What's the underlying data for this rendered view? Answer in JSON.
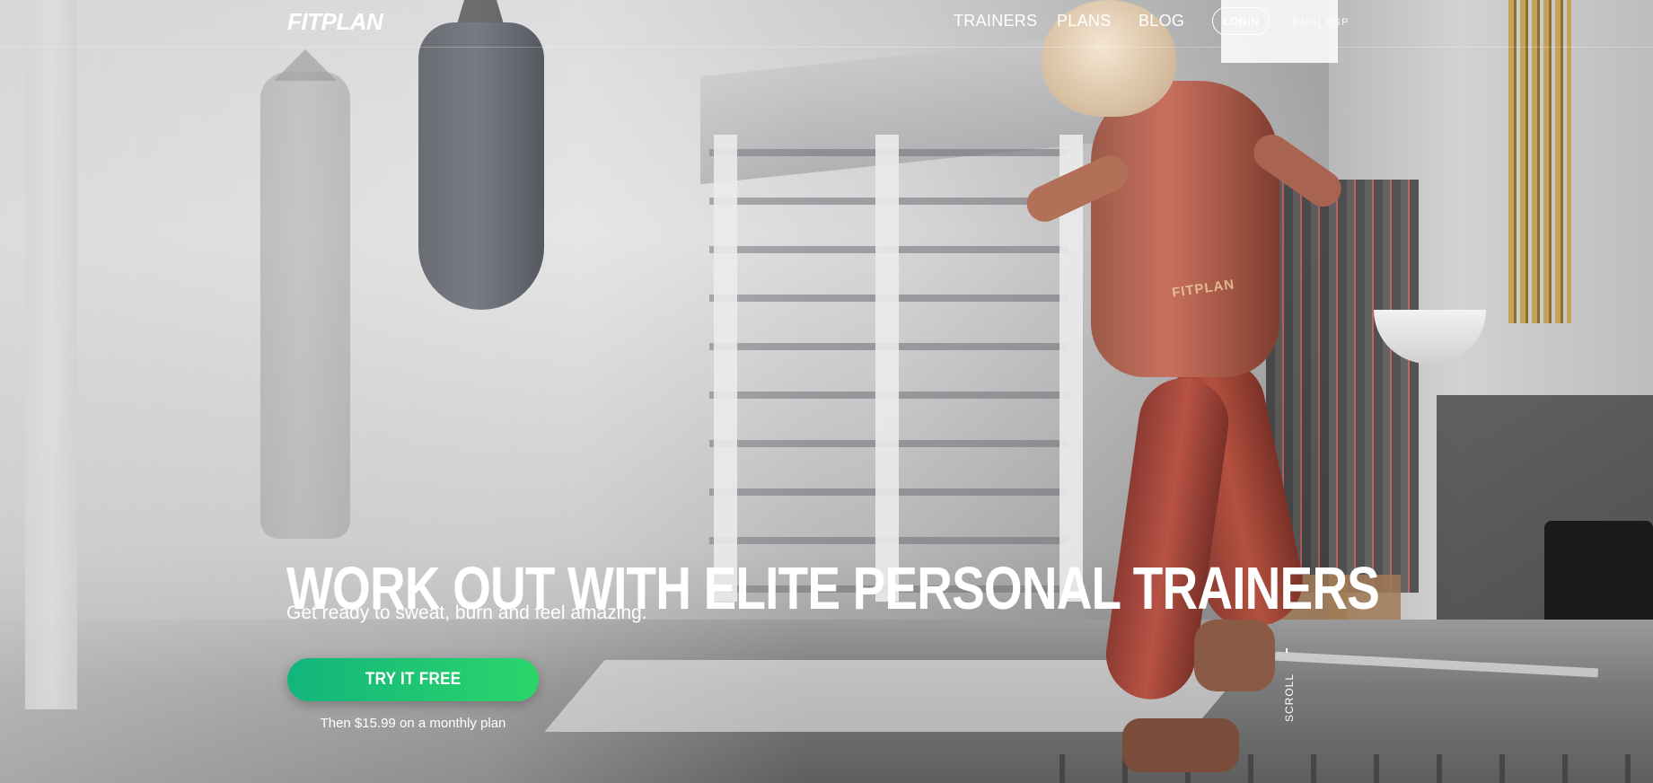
{
  "nav": {
    "logo": "FITPLAN",
    "links": [
      "TRAINERS",
      "PLANS",
      "BLOG"
    ],
    "login": "LOGIN",
    "languages": [
      "ENG",
      "ESP"
    ]
  },
  "hero": {
    "headline": "WORK OUT WITH ELITE PERSONAL TRAINERS",
    "subheadline": "Get ready to sweat, burn and feel amazing.",
    "cta_label": "TRY IT FREE",
    "price_note": "Then $15.99 on a monthly plan",
    "scroll_label": "SCROLL",
    "apparel_logo": "FITPLAN"
  },
  "colors": {
    "cta_gradient_start": "#12b57c",
    "cta_gradient_end": "#2ad66a",
    "text": "#ffffff"
  }
}
